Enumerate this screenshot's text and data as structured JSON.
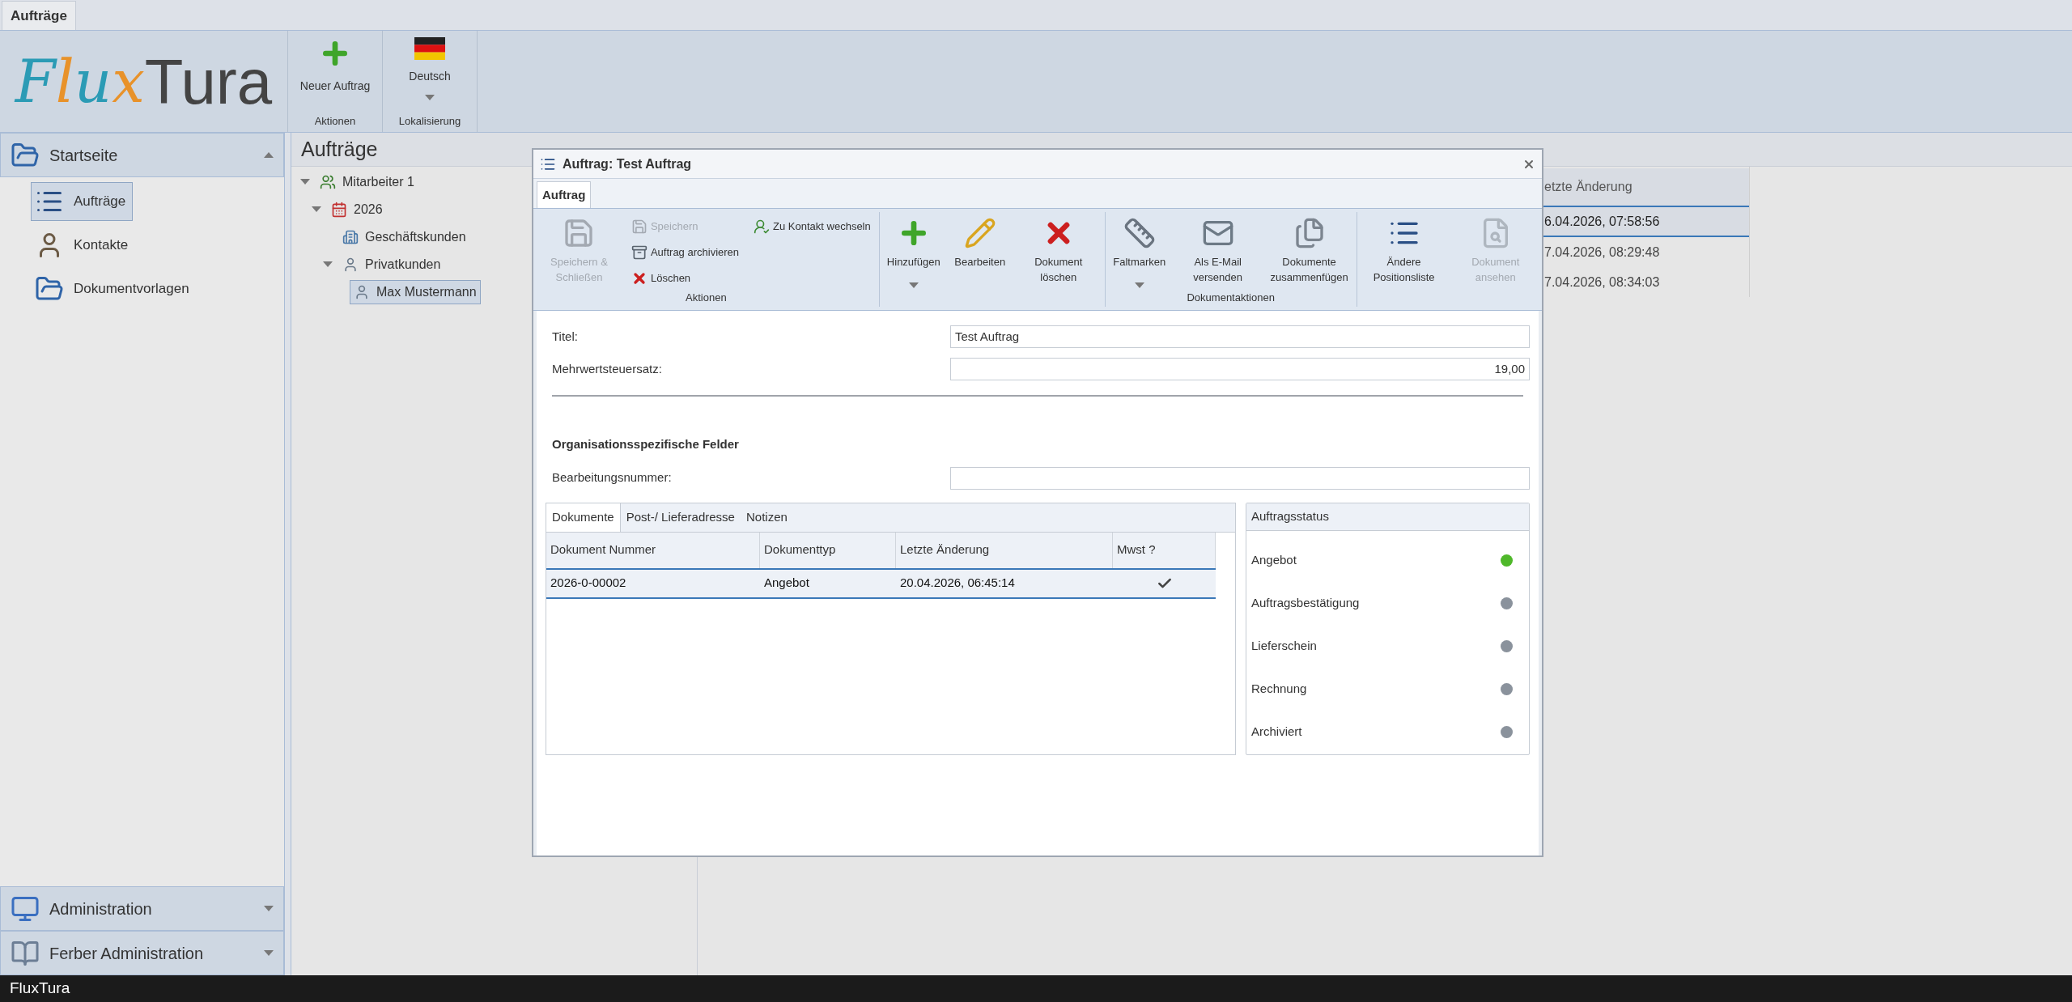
{
  "app_tabs": [
    {
      "label": "Aufträge",
      "selected": true
    }
  ],
  "logo": {
    "script": "Flux",
    "text": "Tura"
  },
  "ribbon": [
    {
      "label": "Aktionen",
      "buttons": [
        {
          "label": "Neuer Auftrag"
        }
      ]
    },
    {
      "label": "Lokalisierung",
      "buttons": [
        {
          "label": "Deutsch",
          "dropdown": true
        }
      ]
    }
  ],
  "sidebar": [
    {
      "label": "Startseite",
      "expanded": true,
      "items": [
        {
          "label": "Aufträge",
          "selected": true
        },
        {
          "label": "Kontakte",
          "selected": false
        },
        {
          "label": "Dokumentvorlagen",
          "selected": false
        }
      ]
    },
    {
      "label": "Administration",
      "expanded": false
    },
    {
      "label": "Ferber Administration",
      "expanded": false
    }
  ],
  "content": {
    "title": "Aufträge",
    "tree": [
      {
        "label": "Mitarbeiter 1",
        "expanded": true,
        "selected": false,
        "children": [
          {
            "label": "2026",
            "expanded": true,
            "selected": false,
            "children": [
              {
                "label": "Geschäftskunden",
                "selected": false
              },
              {
                "label": "Privatkunden",
                "expanded": true,
                "selected": false,
                "children": [
                  {
                    "label": "Max Mustermann",
                    "selected": true
                  }
                ]
              }
            ]
          }
        ]
      }
    ],
    "grid": {
      "column": "etzte Änderung",
      "rows": [
        {
          "value": "6.04.2026, 07:58:56",
          "selected": true
        },
        {
          "value": "7.04.2026, 08:29:48",
          "selected": false
        },
        {
          "value": "7.04.2026, 08:34:03",
          "selected": false
        }
      ]
    }
  },
  "dialog": {
    "title": "Auftrag: Test Auftrag",
    "tabs": [
      {
        "label": "Auftrag",
        "selected": true
      }
    ],
    "ribbon": [
      {
        "label": "Aktionen",
        "buttons": [
          {
            "label": "Speichern & Schließen",
            "kind": "large",
            "disabled": true
          },
          {
            "label": "Speichern",
            "kind": "small",
            "disabled": true
          },
          {
            "label": "Auftrag archivieren",
            "kind": "small",
            "disabled": false
          },
          {
            "label": "Löschen",
            "kind": "small",
            "disabled": false
          },
          {
            "label": "Zu Kontakt wechseln",
            "kind": "small",
            "disabled": false
          }
        ]
      },
      {
        "buttons": [
          {
            "label": "Hinzufügen",
            "kind": "large",
            "disabled": false,
            "dropdown": true
          },
          {
            "label": "Bearbeiten",
            "kind": "large",
            "disabled": false
          },
          {
            "label": "Dokument löschen",
            "kind": "large",
            "disabled": false
          }
        ]
      },
      {
        "label": "Dokumentaktionen",
        "buttons": [
          {
            "label": "Faltmarken",
            "kind": "large",
            "disabled": false,
            "dropdown": true
          },
          {
            "label": "Als E-Mail versenden",
            "kind": "large",
            "disabled": false
          },
          {
            "label": "Dokumente zusammenfügen",
            "kind": "large",
            "disabled": false
          }
        ]
      },
      {
        "buttons": [
          {
            "label": "Ändere Positionsliste",
            "kind": "large",
            "disabled": false
          },
          {
            "label": "Dokument ansehen",
            "kind": "large",
            "disabled": true
          }
        ]
      }
    ],
    "fields": [
      {
        "label": "Titel:",
        "value": "Test Auftrag"
      },
      {
        "label": "Mehrwertsteuersatz:",
        "value": "19,00"
      }
    ],
    "section_heading": "Organisationsspezifische Felder",
    "extra_fields": [
      {
        "label": "Bearbeitungsnummer:"
      }
    ],
    "doc_tabs": [
      {
        "label": "Dokumente",
        "selected": true
      },
      {
        "label": "Post-/ Lieferadresse",
        "selected": false
      },
      {
        "label": "Notizen",
        "selected": false
      }
    ],
    "table": {
      "columns": [
        "Dokument Nummer",
        "Dokumenttyp",
        "Letzte Änderung",
        "Mwst ?"
      ],
      "rows": [
        {
          "cells": [
            "2026-0-00002",
            "Angebot",
            "20.04.2026, 06:45:14"
          ],
          "mwst": true,
          "selected": true
        }
      ]
    },
    "status": {
      "title": "Auftragsstatus",
      "items": [
        {
          "label": "Angebot",
          "color": "#4fb82a"
        },
        {
          "label": "Auftragsbestätigung",
          "color": "#8a929c"
        },
        {
          "label": "Lieferschein",
          "color": "#8a929c"
        },
        {
          "label": "Rechnung",
          "color": "#8a929c"
        },
        {
          "label": "Archiviert",
          "color": "#8a929c"
        }
      ]
    }
  },
  "status_bar": "FluxTura"
}
